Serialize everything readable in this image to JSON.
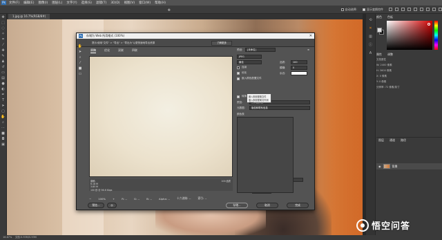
{
  "app": {
    "logo": "Ps",
    "menu": [
      "文件(F)",
      "编辑(E)",
      "图像(I)",
      "图层(L)",
      "文字(Y)",
      "选择(S)",
      "滤镜(T)",
      "3D(D)",
      "视图(V)",
      "窗口(W)",
      "帮助(H)"
    ]
  },
  "options_bar": {
    "auto_select_label": "自动选择:",
    "show_transform_label": "显示变换控件"
  },
  "document": {
    "tab_title": "1.jpg @ 16.7%(RGB/8#)"
  },
  "status": {
    "zoom": "16.67%",
    "doc_info": "文档:5.93M/5.93M"
  },
  "right_panel": {
    "color_tabs": [
      "颜色",
      "色板"
    ],
    "props_tabs": [
      "属性",
      "调整"
    ],
    "props_title": "文档属性",
    "props_lines": [
      "W: 2400 像素",
      "H: 3600 像素",
      "X: 0 像素",
      "Y: 0 像素",
      "分辨率: 72 像素/英寸"
    ],
    "layers_tabs": [
      "图层",
      "通道",
      "路径"
    ],
    "layer_name": "背景"
  },
  "dialog": {
    "title": "存储为 Web 所用格式 (100%)",
    "tip": "提示:使用\"文件\" > \"导出\" > \"导出为\"以更快速地导出资源",
    "learn_more": "了解更多",
    "view_tabs": [
      "原稿",
      "优化",
      "双联",
      "四联"
    ],
    "active_tab": "原稿",
    "preset_label": "预设:",
    "preset_value": "[未命名]",
    "format": "JPEG",
    "quality_level": "最佳",
    "quality_label": "品质:",
    "quality_value": "100",
    "progressive": "连续",
    "blur_label": "模糊:",
    "blur_value": "0",
    "optimized": "优化",
    "matte_label": "杂边:",
    "embed_profile": "嵌入颜色配置文件",
    "popup_line1": "嵌入颜色配置文件",
    "popup_line2": "嵌入颜色配置文件到JPEG",
    "convert_srgb": "转换为 sRGB",
    "preview_label": "预览:",
    "preview_value": "显示器颜色",
    "metadata_label": "元数据:",
    "metadata_value": "版权和联系信息",
    "color_table": "颜色表",
    "image_size": "图像大小",
    "width_label": "W:",
    "width_value": "1800",
    "height_label": "H:",
    "height_value": "1200",
    "unit": "像素",
    "percent_label": "百分比:",
    "percent_value": "100",
    "quality2_label": "品质:",
    "quality2_value": "两次立方",
    "animation": "动画",
    "loop_label": "循环选项:",
    "loop_value": "永远",
    "orig_info1": "原稿:",
    "orig_info2": "6.18 M",
    "orig_info3": "3.85 M",
    "orig_speed": "100 秒 @ 56.6 Kbps",
    "zoom_value": "100%",
    "preview_footer": "100 品质",
    "fields": [
      "R: --",
      "G: --",
      "B: --",
      "Alpha: --",
      "十六进制: --",
      "索引: --"
    ],
    "btn_preview": "预览...",
    "btn_save": "存储...",
    "btn_cancel": "取消",
    "btn_done": "完成"
  },
  "watermark": {
    "text": "悟空问答"
  }
}
